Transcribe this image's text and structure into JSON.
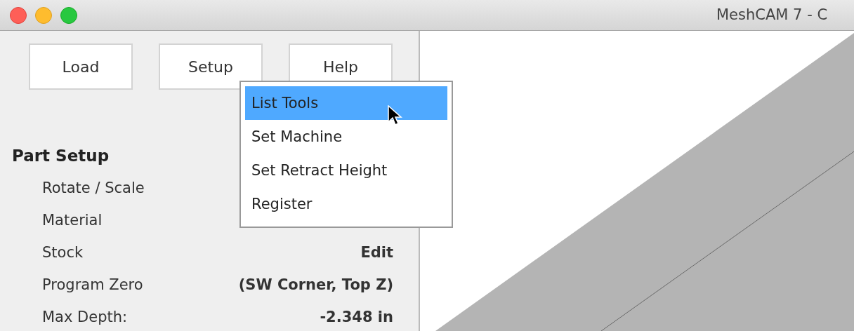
{
  "window": {
    "title": "MeshCAM 7 - C"
  },
  "toolbar": {
    "buttons": [
      {
        "label": "Load"
      },
      {
        "label": "Setup"
      },
      {
        "label": "Help"
      }
    ]
  },
  "menu": {
    "items": [
      {
        "label": "List Tools",
        "selected": true
      },
      {
        "label": "Set Machine",
        "selected": false
      },
      {
        "label": "Set Retract Height",
        "selected": false
      },
      {
        "label": "Register",
        "selected": false
      }
    ]
  },
  "part_setup": {
    "heading": "Part Setup",
    "rows": [
      {
        "label": "Rotate / Scale"
      },
      {
        "label": "Material"
      },
      {
        "label": "Stock",
        "value": "Edit"
      },
      {
        "label": "Program Zero",
        "value": "(SW Corner, Top Z)"
      },
      {
        "label": "Max Depth:",
        "value": "-2.348 in"
      }
    ]
  }
}
